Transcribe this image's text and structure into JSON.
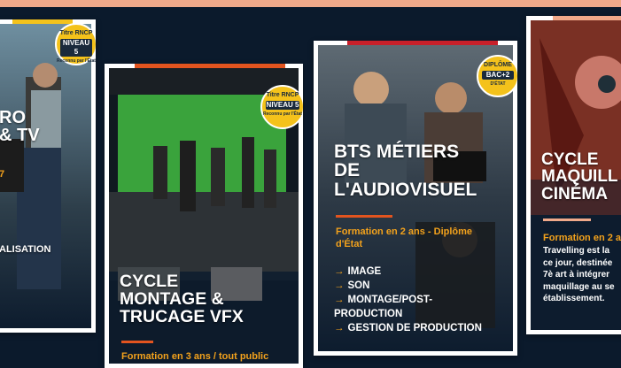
{
  "cards": {
    "realisation": {
      "title_lines": [
        "RO",
        "& TV"
      ],
      "label": "ALISATION",
      "mark": "7",
      "badge": {
        "top": "Titre RNCP",
        "mid": "NIVEAU 5",
        "bot": "Reconnu par l'État"
      }
    },
    "vfx": {
      "title_lines": [
        "CYCLE",
        "MONTAGE &",
        "TRUCAGE VFX"
      ],
      "subtitle": "Formation en 3 ans / tout public",
      "badge": {
        "top": "Titre RNCP",
        "mid": "NIVEAU 5",
        "bot": "Reconnu par l'État"
      }
    },
    "bts": {
      "title_lines": [
        "BTS MÉTIERS",
        "DE",
        "L'AUDIOVISUEL"
      ],
      "subtitle": "Formation en 2 ans - Diplôme d'État",
      "items": [
        "IMAGE",
        "SON",
        "MONTAGE/POST-PRODUCTION",
        "GESTION DE PRODUCTION"
      ],
      "badge": {
        "top": "DIPLÔME",
        "mid": "BAC+2",
        "bot": "D'ÉTAT"
      }
    },
    "maquillage": {
      "title_lines": [
        "CYCLE",
        "MAQUILL",
        "CINÉMA"
      ],
      "subtitle": "Formation en 2 a",
      "desc_lines": [
        "Travelling est la",
        "ce jour, destinée",
        "7è art à intégrer",
        "maquillage au se",
        "établissement."
      ]
    }
  },
  "colors": {
    "background": "#0b1a2c",
    "accent_orange": "#f3a21c",
    "accent_red": "#c8202a",
    "badge_yellow": "#f4c21b"
  }
}
